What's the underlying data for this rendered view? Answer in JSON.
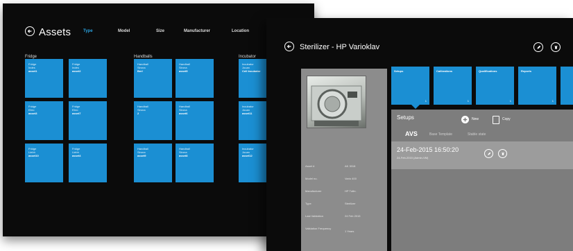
{
  "assets_window": {
    "title": "Assets",
    "nav": [
      "Type",
      "Model",
      "Size",
      "Manufacturer",
      "Location"
    ],
    "groups": [
      {
        "label": "Fridge",
        "tiles": [
          [
            "Fridge",
            "Indes",
            "asset1"
          ],
          [
            "Fridge",
            "Indes",
            "asset2"
          ],
          [
            "Fridge",
            "Ebro",
            "asset3"
          ],
          [
            "Fridge",
            "Ebro",
            "asset7"
          ],
          [
            "Fridge",
            "Liebh",
            "asset10"
          ],
          [
            "Fridge",
            "Liebh",
            "asset4"
          ]
        ]
      },
      {
        "label": "Handballs",
        "tiles": [
          [
            "Handball",
            "Sirona",
            "Berl"
          ],
          [
            "Handball",
            "Sirona",
            "asset5"
          ],
          [
            "Handball",
            "Sirona",
            "2"
          ],
          [
            "Handball",
            "Sirona",
            "asset6"
          ],
          [
            "Handball",
            "Sirona",
            "asset9"
          ],
          [
            "Handball",
            "Sirona",
            "asset8"
          ]
        ]
      },
      {
        "label": "Incubator",
        "tiles": [
          [
            "Incubator",
            "Jouan",
            "Cell Incubator"
          ],
          [
            "Incubator",
            "Jouan",
            "asset11"
          ],
          [
            "Incubator",
            "Jouan",
            "asset12"
          ]
        ]
      }
    ]
  },
  "sterilizer_window": {
    "title": "Sterilizer - HP Varioklav",
    "info": [
      {
        "label": "Asset #",
        "value": "AK 3018"
      },
      {
        "label": "Model no.",
        "value": "Vario 400"
      },
      {
        "label": "Manufacturer",
        "value": "HP Tuttn."
      },
      {
        "label": "Type",
        "value": "Sterilizer"
      },
      {
        "label": "Last Validation",
        "value": "24 Feb 2015"
      },
      {
        "label": "Validation Frequency",
        "value": "1 Years"
      }
    ],
    "tiles": [
      {
        "label": "Setups",
        "count": "1"
      },
      {
        "label": "Calibrations",
        "count": "1"
      },
      {
        "label": "Qualifications",
        "count": "1"
      },
      {
        "label": "Reports",
        "count": "1"
      },
      {
        "label": "",
        "count": ""
      }
    ],
    "setups": {
      "title": "Setups",
      "new_label": "New",
      "copy_label": "Copy",
      "tabs": [
        "AVS",
        "Base Template",
        "Stable state"
      ],
      "entry_date": "24-Feb-2015 16:50:20",
      "entry_sub": "24-Feb-2015 (Admin-VM)"
    }
  },
  "colors": {
    "tile": "#1b8fd3",
    "background": "#0b0b0b",
    "accent_nav": "#2aa3e0"
  }
}
